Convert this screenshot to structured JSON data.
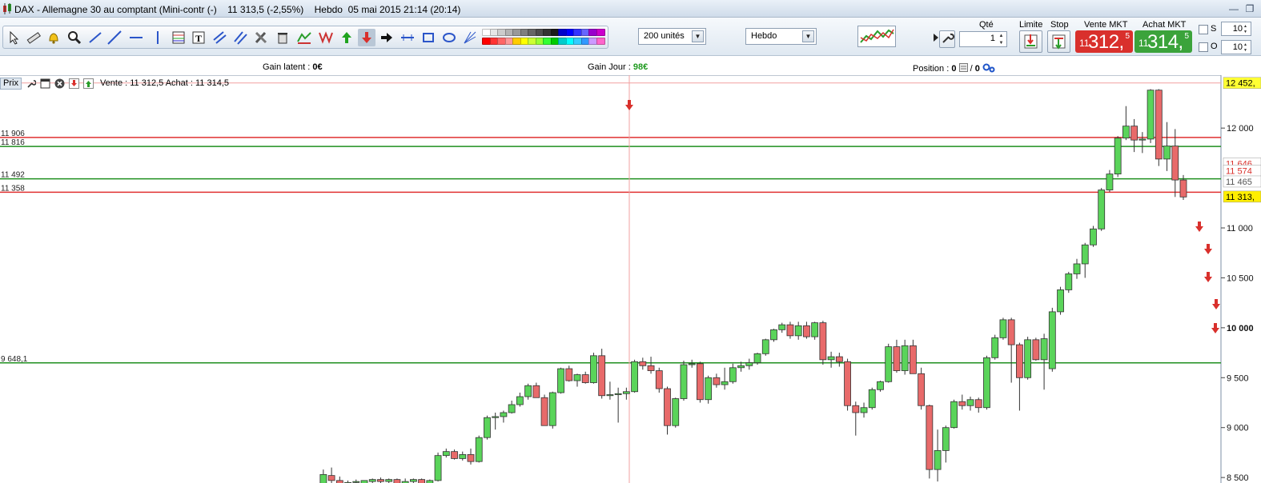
{
  "window": {
    "title": "DAX - Allemagne 30 au comptant (Mini-contr (-)    11 313,5 (-2,55%)    Hebdo  05 mai 2015 21:14 (20:14)"
  },
  "toolbar": {
    "units_select": "200 unités",
    "period_select": "Hebdo",
    "palette_colors": [
      "#ffffff",
      "#e6e6e6",
      "#cccccc",
      "#b3b3b3",
      "#999999",
      "#7f7f7f",
      "#666666",
      "#4d4d4d",
      "#333333",
      "#1a1a1a",
      "#0000cc",
      "#0000ff",
      "#3333ff",
      "#6666ff",
      "#9900cc",
      "#cc00cc",
      "#ff0000",
      "#ff3333",
      "#ff6666",
      "#ff9999",
      "#ffcc00",
      "#ffff00",
      "#ccff33",
      "#99ff33",
      "#33ff33",
      "#00cc00",
      "#00cccc",
      "#00ffff",
      "#33ccff",
      "#3399ff",
      "#cc99ff",
      "#ff66cc"
    ]
  },
  "trade": {
    "qty_label": "Qté",
    "qty_value": "1",
    "limit_label": "Limite",
    "stop_label": "Stop",
    "sell_label": "Vente MKT",
    "buy_label": "Achat MKT",
    "sell_small": "11",
    "sell_big": "312,",
    "sell_sup": "5",
    "buy_small": "11",
    "buy_big": "314,",
    "buy_sup": "5",
    "s_label": "S",
    "o_label": "O",
    "s_value": "10",
    "o_value": "10",
    "sell_color": "#d9302c",
    "buy_color": "#3ba33b"
  },
  "info": {
    "gain_latent_label": "Gain latent : ",
    "gain_latent_value": "0€",
    "gain_jour_label": "Gain Jour : ",
    "gain_jour_value": "98€",
    "position_label": "Position : ",
    "position_value_1": "0",
    "position_sep": " / ",
    "position_value_2": "0"
  },
  "legend": {
    "prix": "Prix",
    "quote": "Vente : 11 312,5 Achat : 11 314,5"
  },
  "chart_data": {
    "type": "candlestick",
    "period": "Hebdo",
    "y_axis_ticks": [
      {
        "v": 8500,
        "label": "8 500"
      },
      {
        "v": 9000,
        "label": "9 000"
      },
      {
        "v": 9500,
        "label": "9 500"
      },
      {
        "v": 10000,
        "label": "10 000"
      },
      {
        "v": 10500,
        "label": "10 500"
      },
      {
        "v": 11000,
        "label": "11 000"
      },
      {
        "v": 12000,
        "label": "12 000"
      }
    ],
    "ylim": [
      8445,
      12530
    ],
    "price_tags": [
      {
        "v": 12452,
        "label": "12 452,",
        "bg": "#ffff33",
        "fg": "#000000"
      },
      {
        "v": 11646,
        "label": "11 646",
        "bg": "#ffffff",
        "fg": "#d9302c"
      },
      {
        "v": 11574,
        "label": "11 574",
        "bg": "#ffffff",
        "fg": "#d9302c"
      },
      {
        "v": 11465,
        "label": "11 465",
        "bg": "#ffffff",
        "fg": "#555555"
      },
      {
        "v": 11313.5,
        "label": "11 313,",
        "bg": "#ffee00",
        "fg": "#000000"
      }
    ],
    "horizontal_lines": [
      {
        "v": 12452,
        "color": "#f2a0a0",
        "label": ""
      },
      {
        "v": 11906,
        "color": "#e03030",
        "label": "11 906"
      },
      {
        "v": 11816,
        "color": "#1f8f1f",
        "label": "11 816"
      },
      {
        "v": 11492,
        "color": "#1f8f1f",
        "label": "11 492"
      },
      {
        "v": 11358,
        "color": "#e03030",
        "label": "11 358"
      },
      {
        "v": 9648.1,
        "color": "#1f8f1f",
        "label": "9 648,1"
      }
    ],
    "candles": [
      {
        "o": 8400,
        "h": 8580,
        "l": 8390,
        "c": 8530
      },
      {
        "o": 8520,
        "h": 8600,
        "l": 8430,
        "c": 8470
      },
      {
        "o": 8470,
        "h": 8510,
        "l": 8420,
        "c": 8440
      },
      {
        "o": 8440,
        "h": 8470,
        "l": 8410,
        "c": 8450
      },
      {
        "o": 8450,
        "h": 8480,
        "l": 8430,
        "c": 8460
      },
      {
        "o": 8400,
        "h": 8470,
        "l": 8380,
        "c": 8470
      },
      {
        "o": 8460,
        "h": 8490,
        "l": 8440,
        "c": 8480
      },
      {
        "o": 8480,
        "h": 8500,
        "l": 8430,
        "c": 8460
      },
      {
        "o": 8460,
        "h": 8490,
        "l": 8430,
        "c": 8480
      },
      {
        "o": 8480,
        "h": 8490,
        "l": 8410,
        "c": 8430
      },
      {
        "o": 8430,
        "h": 8490,
        "l": 8400,
        "c": 8460
      },
      {
        "o": 8460,
        "h": 8490,
        "l": 8430,
        "c": 8480
      },
      {
        "o": 8480,
        "h": 8490,
        "l": 8420,
        "c": 8440
      },
      {
        "o": 8440,
        "h": 8480,
        "l": 8420,
        "c": 8470
      },
      {
        "o": 8470,
        "h": 8750,
        "l": 8460,
        "c": 8720
      },
      {
        "o": 8720,
        "h": 8790,
        "l": 8700,
        "c": 8760
      },
      {
        "o": 8760,
        "h": 8780,
        "l": 8680,
        "c": 8690
      },
      {
        "o": 8690,
        "h": 8760,
        "l": 8670,
        "c": 8730
      },
      {
        "o": 8730,
        "h": 8790,
        "l": 8630,
        "c": 8660
      },
      {
        "o": 8660,
        "h": 8920,
        "l": 8650,
        "c": 8900
      },
      {
        "o": 8900,
        "h": 9120,
        "l": 8880,
        "c": 9100
      },
      {
        "o": 9100,
        "h": 9150,
        "l": 8980,
        "c": 9110
      },
      {
        "o": 9110,
        "h": 9170,
        "l": 9050,
        "c": 9150
      },
      {
        "o": 9150,
        "h": 9270,
        "l": 9140,
        "c": 9230
      },
      {
        "o": 9230,
        "h": 9350,
        "l": 9210,
        "c": 9310
      },
      {
        "o": 9310,
        "h": 9440,
        "l": 9280,
        "c": 9420
      },
      {
        "o": 9420,
        "h": 9450,
        "l": 9300,
        "c": 9300
      },
      {
        "o": 9300,
        "h": 9330,
        "l": 9020,
        "c": 9020
      },
      {
        "o": 9020,
        "h": 9360,
        "l": 8990,
        "c": 9350
      },
      {
        "o": 9350,
        "h": 9600,
        "l": 9340,
        "c": 9590
      },
      {
        "o": 9590,
        "h": 9620,
        "l": 9460,
        "c": 9470
      },
      {
        "o": 9470,
        "h": 9540,
        "l": 9410,
        "c": 9530
      },
      {
        "o": 9530,
        "h": 9560,
        "l": 9440,
        "c": 9450
      },
      {
        "o": 9450,
        "h": 9750,
        "l": 9440,
        "c": 9720
      },
      {
        "o": 9720,
        "h": 9790,
        "l": 9290,
        "c": 9320
      },
      {
        "o": 9320,
        "h": 9460,
        "l": 9280,
        "c": 9330
      },
      {
        "o": 9330,
        "h": 9400,
        "l": 9050,
        "c": 9340
      },
      {
        "o": 9340,
        "h": 9400,
        "l": 9280,
        "c": 9360
      },
      {
        "o": 9360,
        "h": 9680,
        "l": 9350,
        "c": 9660
      },
      {
        "o": 9660,
        "h": 9700,
        "l": 9580,
        "c": 9620
      },
      {
        "o": 9620,
        "h": 9710,
        "l": 9540,
        "c": 9570
      },
      {
        "o": 9570,
        "h": 9600,
        "l": 9350,
        "c": 9390
      },
      {
        "o": 9390,
        "h": 9410,
        "l": 8930,
        "c": 9020
      },
      {
        "o": 9020,
        "h": 9300,
        "l": 9000,
        "c": 9290
      },
      {
        "o": 9290,
        "h": 9670,
        "l": 9270,
        "c": 9630
      },
      {
        "o": 9630,
        "h": 9680,
        "l": 9600,
        "c": 9640
      },
      {
        "o": 9640,
        "h": 9660,
        "l": 9250,
        "c": 9280
      },
      {
        "o": 9280,
        "h": 9520,
        "l": 9240,
        "c": 9500
      },
      {
        "o": 9500,
        "h": 9540,
        "l": 9400,
        "c": 9430
      },
      {
        "o": 9430,
        "h": 9600,
        "l": 9380,
        "c": 9460
      },
      {
        "o": 9460,
        "h": 9640,
        "l": 9440,
        "c": 9600
      },
      {
        "o": 9600,
        "h": 9660,
        "l": 9560,
        "c": 9620
      },
      {
        "o": 9620,
        "h": 9690,
        "l": 9580,
        "c": 9650
      },
      {
        "o": 9650,
        "h": 9750,
        "l": 9630,
        "c": 9740
      },
      {
        "o": 9740,
        "h": 9890,
        "l": 9720,
        "c": 9880
      },
      {
        "o": 9880,
        "h": 9990,
        "l": 9860,
        "c": 9980
      },
      {
        "o": 9980,
        "h": 10050,
        "l": 9950,
        "c": 10030
      },
      {
        "o": 10030,
        "h": 10060,
        "l": 9890,
        "c": 9920
      },
      {
        "o": 9920,
        "h": 10060,
        "l": 9880,
        "c": 10020
      },
      {
        "o": 10020,
        "h": 10060,
        "l": 9890,
        "c": 9910
      },
      {
        "o": 9910,
        "h": 10060,
        "l": 9880,
        "c": 10050
      },
      {
        "o": 10050,
        "h": 10070,
        "l": 9630,
        "c": 9680
      },
      {
        "o": 9680,
        "h": 9760,
        "l": 9600,
        "c": 9710
      },
      {
        "o": 9710,
        "h": 9750,
        "l": 9610,
        "c": 9660
      },
      {
        "o": 9660,
        "h": 9690,
        "l": 9170,
        "c": 9220
      },
      {
        "o": 9220,
        "h": 9260,
        "l": 8920,
        "c": 9150
      },
      {
        "o": 9150,
        "h": 9250,
        "l": 9100,
        "c": 9200
      },
      {
        "o": 9200,
        "h": 9400,
        "l": 9180,
        "c": 9380
      },
      {
        "o": 9380,
        "h": 9470,
        "l": 9360,
        "c": 9460
      },
      {
        "o": 9460,
        "h": 9840,
        "l": 9450,
        "c": 9810
      },
      {
        "o": 9810,
        "h": 9880,
        "l": 9550,
        "c": 9570
      },
      {
        "o": 9570,
        "h": 9880,
        "l": 9530,
        "c": 9820
      },
      {
        "o": 9820,
        "h": 9880,
        "l": 9580,
        "c": 9540
      },
      {
        "o": 9540,
        "h": 9600,
        "l": 9180,
        "c": 9220
      },
      {
        "o": 9220,
        "h": 9230,
        "l": 8490,
        "c": 8580
      },
      {
        "o": 8580,
        "h": 8980,
        "l": 8460,
        "c": 8770
      },
      {
        "o": 8770,
        "h": 9020,
        "l": 8650,
        "c": 9000
      },
      {
        "o": 9000,
        "h": 9280,
        "l": 8990,
        "c": 9260
      },
      {
        "o": 9260,
        "h": 9330,
        "l": 9180,
        "c": 9220
      },
      {
        "o": 9220,
        "h": 9310,
        "l": 9170,
        "c": 9280
      },
      {
        "o": 9280,
        "h": 9300,
        "l": 9150,
        "c": 9200
      },
      {
        "o": 9200,
        "h": 9720,
        "l": 9180,
        "c": 9700
      },
      {
        "o": 9700,
        "h": 9930,
        "l": 9680,
        "c": 9900
      },
      {
        "o": 9900,
        "h": 10100,
        "l": 9880,
        "c": 10080
      },
      {
        "o": 10080,
        "h": 10100,
        "l": 9450,
        "c": 9830
      },
      {
        "o": 9830,
        "h": 9850,
        "l": 9170,
        "c": 9500
      },
      {
        "o": 9500,
        "h": 9910,
        "l": 9480,
        "c": 9880
      },
      {
        "o": 9880,
        "h": 9900,
        "l": 9670,
        "c": 9680
      },
      {
        "o": 9680,
        "h": 9940,
        "l": 9380,
        "c": 9890
      },
      {
        "o": 9590,
        "h": 10200,
        "l": 9560,
        "c": 10160
      },
      {
        "o": 10160,
        "h": 10410,
        "l": 10130,
        "c": 10380
      },
      {
        "o": 10380,
        "h": 10560,
        "l": 10350,
        "c": 10540
      },
      {
        "o": 10540,
        "h": 10690,
        "l": 10490,
        "c": 10640
      },
      {
        "o": 10640,
        "h": 10850,
        "l": 10500,
        "c": 10830
      },
      {
        "o": 10830,
        "h": 11020,
        "l": 10810,
        "c": 10990
      },
      {
        "o": 10990,
        "h": 11400,
        "l": 10970,
        "c": 11380
      },
      {
        "o": 11380,
        "h": 11580,
        "l": 11360,
        "c": 11540
      },
      {
        "o": 11540,
        "h": 11920,
        "l": 11510,
        "c": 11900
      },
      {
        "o": 11900,
        "h": 12220,
        "l": 11880,
        "c": 12020
      },
      {
        "o": 12020,
        "h": 12090,
        "l": 11760,
        "c": 11880
      },
      {
        "o": 11880,
        "h": 11960,
        "l": 11750,
        "c": 11890
      },
      {
        "o": 11890,
        "h": 12390,
        "l": 11850,
        "c": 12380
      },
      {
        "o": 12380,
        "h": 12390,
        "l": 11620,
        "c": 11690
      },
      {
        "o": 11690,
        "h": 12060,
        "l": 11570,
        "c": 11820
      },
      {
        "o": 11820,
        "h": 11990,
        "l": 11310,
        "c": 11480
      },
      {
        "o": 11480,
        "h": 11530,
        "l": 11280,
        "c": 11310
      }
    ]
  }
}
